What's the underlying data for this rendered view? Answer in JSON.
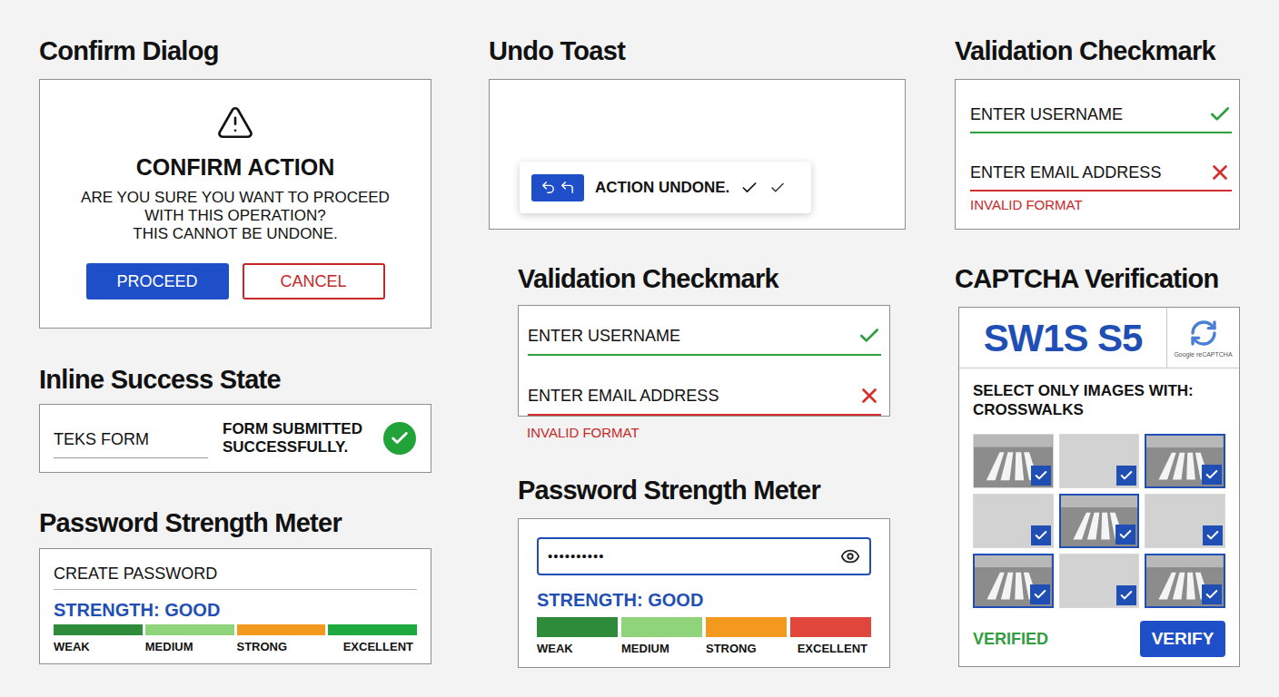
{
  "confirm_dialog": {
    "heading": "Confirm Dialog",
    "title": "CONFIRM ACTION",
    "message": [
      "ARE YOU SURE YOU WANT TO PROCEED",
      "WITH THIS OPERATION?",
      "THIS CANNOT BE UNDONE."
    ],
    "buttons": [
      {
        "label": "PROCEED",
        "kind": "primary"
      },
      {
        "label": "CANCEL",
        "kind": "secondary"
      }
    ]
  },
  "undo_toast": {
    "heading": "Undo Toast",
    "message": "ACTION UNDONE."
  },
  "inline_success": {
    "heading": "Inline Success State",
    "field": "TEKS FORM",
    "message": "FORM SUBMITTED SUCCESSFULLY.",
    "success": true
  },
  "password_meter_left": {
    "heading": "Password Strength Meter",
    "label": "CREATE PASSWORD",
    "strength": "STRENGTH: GOOD",
    "segments": [
      {
        "label": "WEAK",
        "color": "#2e8b3a"
      },
      {
        "label": "MEDIUM",
        "color": "#8fd47a"
      },
      {
        "label": "STRONG",
        "color": "#f39a1e"
      },
      {
        "label": "EXCELLENT",
        "color": "#1faa3f"
      }
    ]
  },
  "validation_middle": {
    "heading": "Validation Checkmark",
    "fields": [
      {
        "label": "ENTER USERNAME",
        "valid": true
      },
      {
        "label": "ENTER EMAIL ADDRESS",
        "valid": false
      }
    ],
    "error": "INVALID FORMAT"
  },
  "password_meter_middle": {
    "heading": "Password Strength Meter",
    "value": "••••••••••",
    "strength": "STRENGTH: GOOD",
    "segments": [
      {
        "label": "WEAK",
        "color": "#2e8b3a"
      },
      {
        "label": "MEDIUM",
        "color": "#8fd47a"
      },
      {
        "label": "STRONG",
        "color": "#f39a1e"
      },
      {
        "label": "EXCELLENT",
        "color": "#e0463c"
      }
    ]
  },
  "validation_right": {
    "heading": "Validation Checkmark",
    "fields": [
      {
        "label": "ENTER USERNAME",
        "valid": true
      },
      {
        "label": "ENTER EMAIL ADDRESS",
        "valid": false
      }
    ],
    "error": "INVALID FORMAT"
  },
  "captcha": {
    "heading": "CAPTCHA Verification",
    "code": "SW1S S5",
    "brand": "Google reCAPTCHA",
    "instruction": [
      "SELECT ONLY IMAGES WITH:",
      "CROSSWALKS"
    ],
    "tiles": [
      {
        "kind": "crosswalk",
        "highlighted": false,
        "checked": true
      },
      {
        "kind": "empty",
        "highlighted": false,
        "checked": true
      },
      {
        "kind": "crosswalk",
        "highlighted": true,
        "checked": true
      },
      {
        "kind": "empty",
        "highlighted": false,
        "checked": true
      },
      {
        "kind": "crosswalk",
        "highlighted": true,
        "checked": true
      },
      {
        "kind": "empty",
        "highlighted": false,
        "checked": true
      },
      {
        "kind": "crosswalk",
        "highlighted": true,
        "checked": true
      },
      {
        "kind": "empty",
        "highlighted": false,
        "checked": true
      },
      {
        "kind": "crosswalk",
        "highlighted": true,
        "checked": true
      }
    ],
    "status": "VERIFIED",
    "button": "VERIFY"
  }
}
